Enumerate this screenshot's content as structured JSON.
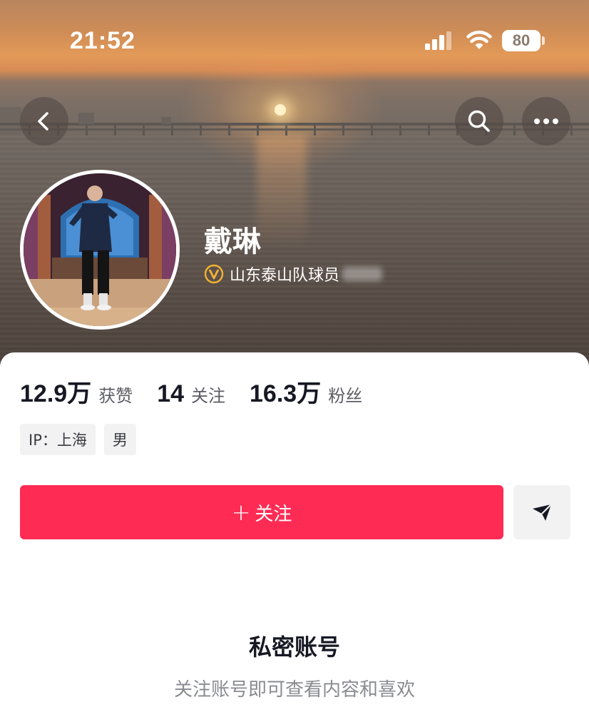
{
  "status_bar": {
    "time": "21:52",
    "battery_level": "80",
    "icons": [
      "signal-icon",
      "wifi-icon",
      "battery-icon"
    ]
  },
  "header": {
    "back_icon": "chevron-left-icon",
    "search_icon": "search-icon",
    "more_icon": "more-icon"
  },
  "profile": {
    "name": "戴琳",
    "verify_icon": "verified-badge-icon",
    "verification": "山东泰山队球员"
  },
  "stats": [
    {
      "value": "12.9万",
      "label": "获赞"
    },
    {
      "value": "14",
      "label": "关注"
    },
    {
      "value": "16.3万",
      "label": "粉丝"
    }
  ],
  "tags": [
    "IP：上海",
    "男"
  ],
  "actions": {
    "follow_plus": "+",
    "follow_label": "关注",
    "share_icon": "send-icon"
  },
  "private": {
    "title": "私密账号",
    "subtitle": "关注账号即可查看内容和喜欢"
  },
  "colors": {
    "accent": "#fe2c55",
    "text_primary": "#161823",
    "text_secondary": "#8a8b91",
    "tag_bg": "#f2f2f3",
    "verify_gold": "#f2b233"
  }
}
